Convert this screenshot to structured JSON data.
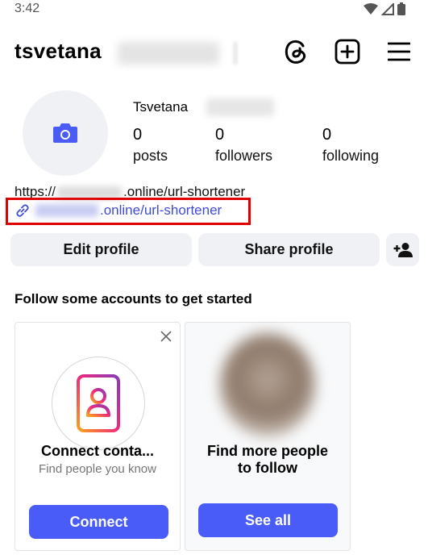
{
  "status": {
    "time": "3:42"
  },
  "header": {
    "username": "tsvetana"
  },
  "profile": {
    "display_name": "Tsvetana",
    "stats": [
      {
        "value": "0",
        "label": "posts"
      },
      {
        "value": "0",
        "label": "followers"
      },
      {
        "value": "0",
        "label": "following"
      }
    ],
    "bio_prefix": "https://",
    "bio_suffix": ".online/url-shortener",
    "link_suffix": ".online/url-shortener"
  },
  "actions": {
    "edit": "Edit profile",
    "share": "Share profile"
  },
  "suggestions": {
    "title": "Follow some accounts to get started",
    "cards": [
      {
        "title": "Connect conta...",
        "subtitle": "Find people you know",
        "button": "Connect"
      },
      {
        "title_line1": "Find more people",
        "title_line2": "to follow",
        "button": "See all"
      }
    ]
  },
  "colors": {
    "accent": "#4a5cf7",
    "link": "#3f4bd8",
    "highlight_box": "#e00000",
    "button_bg": "#eff1f4"
  }
}
